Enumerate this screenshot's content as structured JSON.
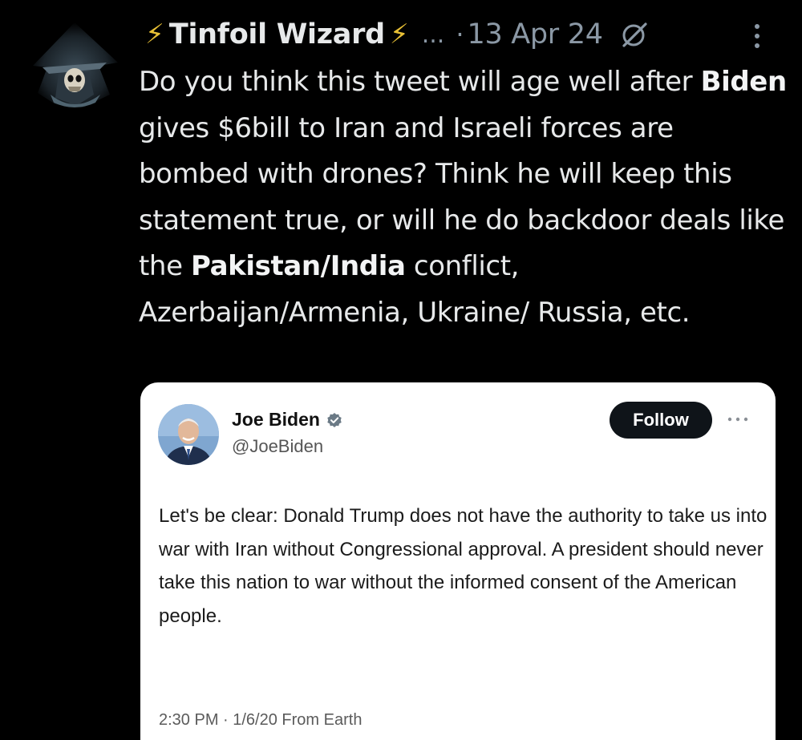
{
  "post": {
    "author": {
      "bolt_left": "⚡",
      "display_name": "Tinfoil Wizard",
      "bolt_right": "⚡",
      "ellipsis": "...",
      "separator": "·",
      "date": "13 Apr 24"
    },
    "icons": {
      "avatar": "skull-wizard-avatar-icon",
      "grok": "grok-icon",
      "more": "more-vertical-icon"
    },
    "text": {
      "t1": "Do you think this tweet will age well after ",
      "b1": "Biden",
      "t2": " gives $6bill to Iran and Israeli forces are bombed with drones? Think he will keep this statement true, or will he do backdoor deals like the ",
      "b2": "Pakistan",
      "t3": "/",
      "b3": "India",
      "t4": " conflict, Azerbaijan/Armenia, Ukraine/ Russia, etc."
    }
  },
  "quoted": {
    "name": "Joe Biden",
    "handle": "@JoeBiden",
    "follow_label": "Follow",
    "text": "Let's be clear: Donald Trump does not have the authority to take us into war with Iran without Congressional approval. A president should never take this nation to war without the informed consent of the American people.",
    "meta": "2:30 PM · 1/6/20 From Earth",
    "icons": {
      "avatar": "profile-photo-icon",
      "badge": "verified-badge-icon",
      "more": "more-horizontal-icon"
    }
  },
  "colors": {
    "background": "#000000",
    "text": "#e7e9ea",
    "muted": "#8b98a5",
    "bolt": "#e8c035",
    "card": "#ffffff"
  }
}
